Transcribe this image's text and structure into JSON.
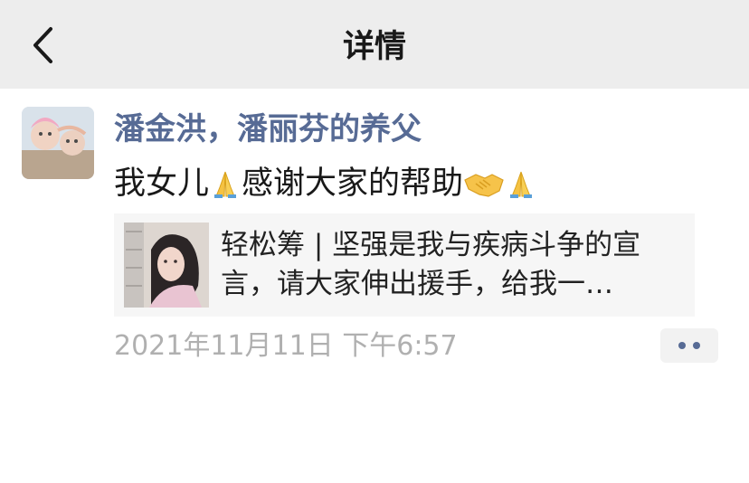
{
  "navbar": {
    "title": "详情",
    "back_icon": "chevron-left-icon"
  },
  "post": {
    "author": "潘金洪，潘丽芬的养父",
    "avatar_icon": "avatar-photo",
    "content": {
      "text_before": "我女儿",
      "emoji_1": "folded-hands",
      "text_middle": "感谢大家的帮助",
      "emoji_2": "handshake",
      "emoji_3": "folded-hands"
    },
    "link": {
      "title": "轻松筹 | 坚强是我与疾病斗争的宣言，请大家伸出援手，给我一…",
      "thumbnail_icon": "thumbnail-photo"
    },
    "timestamp": "2021年11月11日 下午6:57",
    "more_icon": "more-dots-icon"
  },
  "colors": {
    "navbar_bg": "#ededed",
    "author": "#576b95",
    "timestamp": "#b0b0b0",
    "card_bg": "#f6f6f6"
  }
}
